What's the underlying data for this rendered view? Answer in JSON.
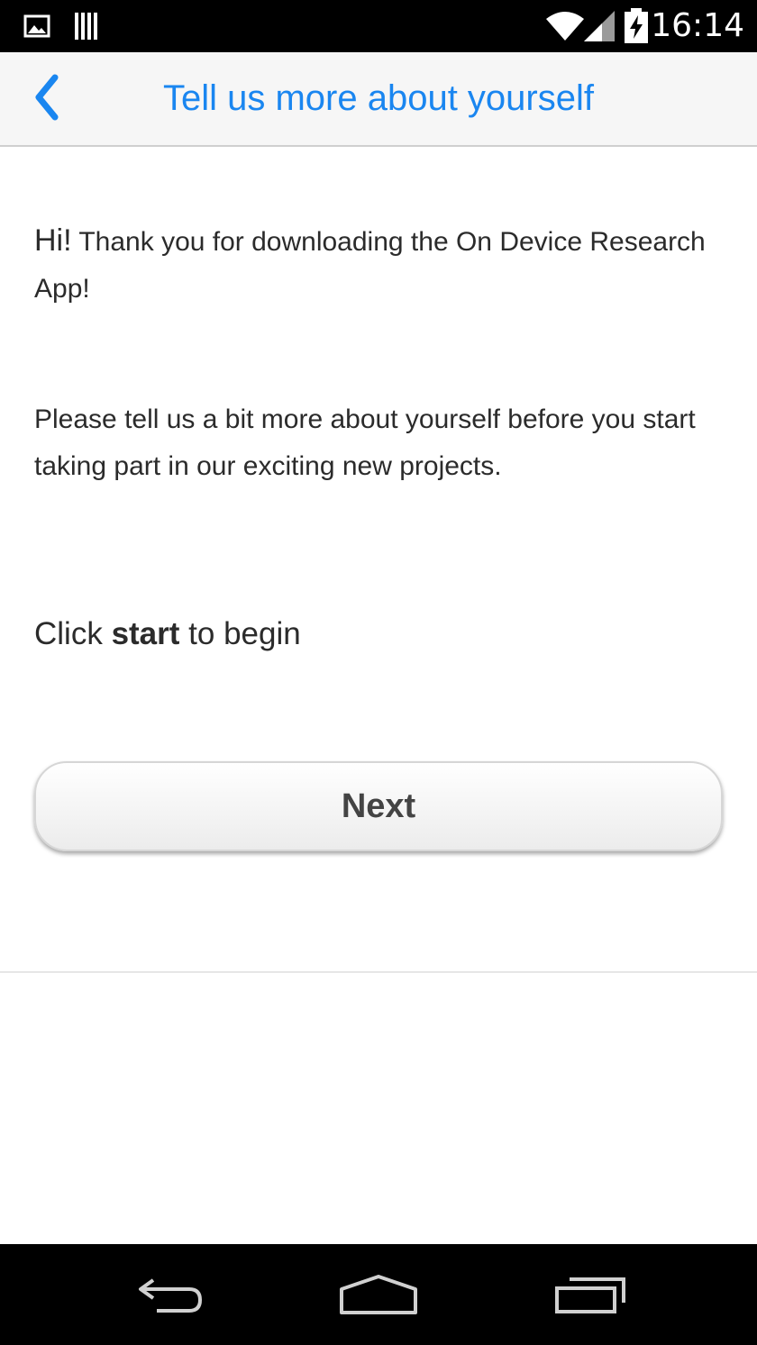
{
  "status_bar": {
    "time": "16:14",
    "icons": [
      "gallery-icon",
      "barcode-icon",
      "wifi-icon",
      "signal-icon",
      "battery-charging-icon"
    ]
  },
  "header": {
    "back_icon": "chevron-left-icon",
    "title": "Tell us more about yourself",
    "accent_color": "#1a86f0"
  },
  "content": {
    "intro_hi": "Hi!",
    "intro_text": " Thank you for downloading the On Device Research App!",
    "please_text": "Please tell us a bit more about yourself before you start taking part in our exciting new projects.",
    "click_prefix": "Click ",
    "click_bold": "start",
    "click_suffix": " to begin"
  },
  "next_button": {
    "label": "Next"
  },
  "nav_bar": {
    "icons": [
      "back-arrow-icon",
      "home-icon",
      "recent-apps-icon"
    ]
  }
}
